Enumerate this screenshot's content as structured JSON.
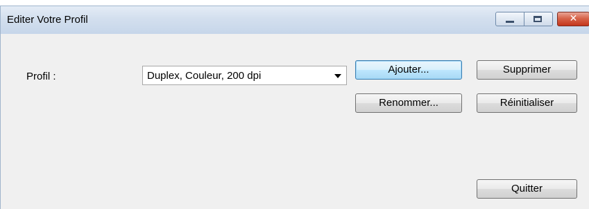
{
  "window": {
    "title": "Editer Votre Profil",
    "title_buttons": [
      "minimize-icon",
      "maximize-icon",
      "close-icon"
    ]
  },
  "form": {
    "profile_label": "Profil :",
    "profile_selected": "Duplex, Couleur, 200 dpi"
  },
  "buttons": {
    "add": "Ajouter...",
    "delete": "Supprimer",
    "rename": "Renommer...",
    "reset": "Réinitialiser",
    "quit": "Quitter"
  },
  "colors": {
    "default_button_border": "#3c7fb1",
    "close_button": "#c4361c"
  }
}
